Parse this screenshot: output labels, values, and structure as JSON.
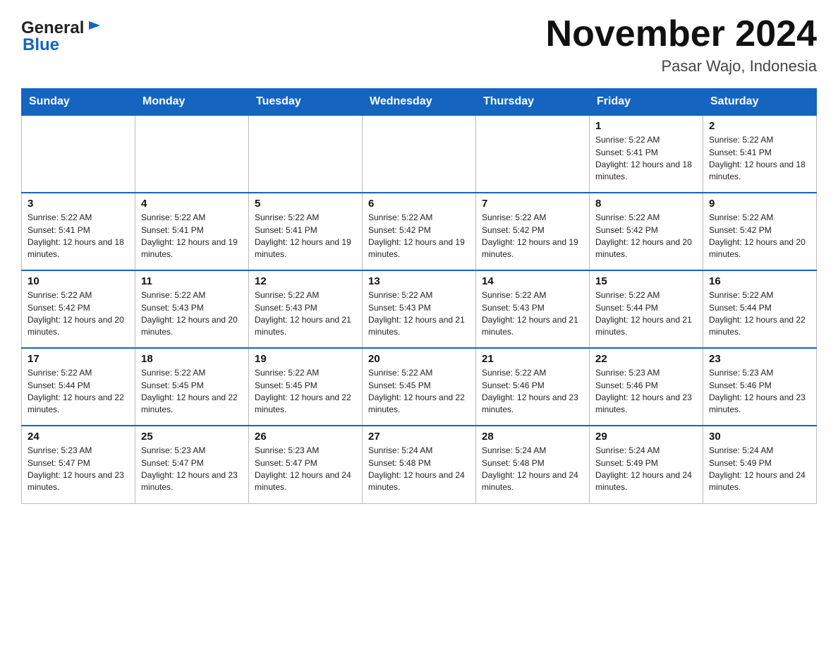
{
  "header": {
    "logo_general": "General",
    "logo_blue": "Blue",
    "month_title": "November 2024",
    "location": "Pasar Wajo, Indonesia"
  },
  "weekdays": [
    "Sunday",
    "Monday",
    "Tuesday",
    "Wednesday",
    "Thursday",
    "Friday",
    "Saturday"
  ],
  "weeks": [
    [
      {
        "day": "",
        "sunrise": "",
        "sunset": "",
        "daylight": "",
        "empty": true
      },
      {
        "day": "",
        "sunrise": "",
        "sunset": "",
        "daylight": "",
        "empty": true
      },
      {
        "day": "",
        "sunrise": "",
        "sunset": "",
        "daylight": "",
        "empty": true
      },
      {
        "day": "",
        "sunrise": "",
        "sunset": "",
        "daylight": "",
        "empty": true
      },
      {
        "day": "",
        "sunrise": "",
        "sunset": "",
        "daylight": "",
        "empty": true
      },
      {
        "day": "1",
        "sunrise": "Sunrise: 5:22 AM",
        "sunset": "Sunset: 5:41 PM",
        "daylight": "Daylight: 12 hours and 18 minutes.",
        "empty": false
      },
      {
        "day": "2",
        "sunrise": "Sunrise: 5:22 AM",
        "sunset": "Sunset: 5:41 PM",
        "daylight": "Daylight: 12 hours and 18 minutes.",
        "empty": false
      }
    ],
    [
      {
        "day": "3",
        "sunrise": "Sunrise: 5:22 AM",
        "sunset": "Sunset: 5:41 PM",
        "daylight": "Daylight: 12 hours and 18 minutes.",
        "empty": false
      },
      {
        "day": "4",
        "sunrise": "Sunrise: 5:22 AM",
        "sunset": "Sunset: 5:41 PM",
        "daylight": "Daylight: 12 hours and 19 minutes.",
        "empty": false
      },
      {
        "day": "5",
        "sunrise": "Sunrise: 5:22 AM",
        "sunset": "Sunset: 5:41 PM",
        "daylight": "Daylight: 12 hours and 19 minutes.",
        "empty": false
      },
      {
        "day": "6",
        "sunrise": "Sunrise: 5:22 AM",
        "sunset": "Sunset: 5:42 PM",
        "daylight": "Daylight: 12 hours and 19 minutes.",
        "empty": false
      },
      {
        "day": "7",
        "sunrise": "Sunrise: 5:22 AM",
        "sunset": "Sunset: 5:42 PM",
        "daylight": "Daylight: 12 hours and 19 minutes.",
        "empty": false
      },
      {
        "day": "8",
        "sunrise": "Sunrise: 5:22 AM",
        "sunset": "Sunset: 5:42 PM",
        "daylight": "Daylight: 12 hours and 20 minutes.",
        "empty": false
      },
      {
        "day": "9",
        "sunrise": "Sunrise: 5:22 AM",
        "sunset": "Sunset: 5:42 PM",
        "daylight": "Daylight: 12 hours and 20 minutes.",
        "empty": false
      }
    ],
    [
      {
        "day": "10",
        "sunrise": "Sunrise: 5:22 AM",
        "sunset": "Sunset: 5:42 PM",
        "daylight": "Daylight: 12 hours and 20 minutes.",
        "empty": false
      },
      {
        "day": "11",
        "sunrise": "Sunrise: 5:22 AM",
        "sunset": "Sunset: 5:43 PM",
        "daylight": "Daylight: 12 hours and 20 minutes.",
        "empty": false
      },
      {
        "day": "12",
        "sunrise": "Sunrise: 5:22 AM",
        "sunset": "Sunset: 5:43 PM",
        "daylight": "Daylight: 12 hours and 21 minutes.",
        "empty": false
      },
      {
        "day": "13",
        "sunrise": "Sunrise: 5:22 AM",
        "sunset": "Sunset: 5:43 PM",
        "daylight": "Daylight: 12 hours and 21 minutes.",
        "empty": false
      },
      {
        "day": "14",
        "sunrise": "Sunrise: 5:22 AM",
        "sunset": "Sunset: 5:43 PM",
        "daylight": "Daylight: 12 hours and 21 minutes.",
        "empty": false
      },
      {
        "day": "15",
        "sunrise": "Sunrise: 5:22 AM",
        "sunset": "Sunset: 5:44 PM",
        "daylight": "Daylight: 12 hours and 21 minutes.",
        "empty": false
      },
      {
        "day": "16",
        "sunrise": "Sunrise: 5:22 AM",
        "sunset": "Sunset: 5:44 PM",
        "daylight": "Daylight: 12 hours and 22 minutes.",
        "empty": false
      }
    ],
    [
      {
        "day": "17",
        "sunrise": "Sunrise: 5:22 AM",
        "sunset": "Sunset: 5:44 PM",
        "daylight": "Daylight: 12 hours and 22 minutes.",
        "empty": false
      },
      {
        "day": "18",
        "sunrise": "Sunrise: 5:22 AM",
        "sunset": "Sunset: 5:45 PM",
        "daylight": "Daylight: 12 hours and 22 minutes.",
        "empty": false
      },
      {
        "day": "19",
        "sunrise": "Sunrise: 5:22 AM",
        "sunset": "Sunset: 5:45 PM",
        "daylight": "Daylight: 12 hours and 22 minutes.",
        "empty": false
      },
      {
        "day": "20",
        "sunrise": "Sunrise: 5:22 AM",
        "sunset": "Sunset: 5:45 PM",
        "daylight": "Daylight: 12 hours and 22 minutes.",
        "empty": false
      },
      {
        "day": "21",
        "sunrise": "Sunrise: 5:22 AM",
        "sunset": "Sunset: 5:46 PM",
        "daylight": "Daylight: 12 hours and 23 minutes.",
        "empty": false
      },
      {
        "day": "22",
        "sunrise": "Sunrise: 5:23 AM",
        "sunset": "Sunset: 5:46 PM",
        "daylight": "Daylight: 12 hours and 23 minutes.",
        "empty": false
      },
      {
        "day": "23",
        "sunrise": "Sunrise: 5:23 AM",
        "sunset": "Sunset: 5:46 PM",
        "daylight": "Daylight: 12 hours and 23 minutes.",
        "empty": false
      }
    ],
    [
      {
        "day": "24",
        "sunrise": "Sunrise: 5:23 AM",
        "sunset": "Sunset: 5:47 PM",
        "daylight": "Daylight: 12 hours and 23 minutes.",
        "empty": false
      },
      {
        "day": "25",
        "sunrise": "Sunrise: 5:23 AM",
        "sunset": "Sunset: 5:47 PM",
        "daylight": "Daylight: 12 hours and 23 minutes.",
        "empty": false
      },
      {
        "day": "26",
        "sunrise": "Sunrise: 5:23 AM",
        "sunset": "Sunset: 5:47 PM",
        "daylight": "Daylight: 12 hours and 24 minutes.",
        "empty": false
      },
      {
        "day": "27",
        "sunrise": "Sunrise: 5:24 AM",
        "sunset": "Sunset: 5:48 PM",
        "daylight": "Daylight: 12 hours and 24 minutes.",
        "empty": false
      },
      {
        "day": "28",
        "sunrise": "Sunrise: 5:24 AM",
        "sunset": "Sunset: 5:48 PM",
        "daylight": "Daylight: 12 hours and 24 minutes.",
        "empty": false
      },
      {
        "day": "29",
        "sunrise": "Sunrise: 5:24 AM",
        "sunset": "Sunset: 5:49 PM",
        "daylight": "Daylight: 12 hours and 24 minutes.",
        "empty": false
      },
      {
        "day": "30",
        "sunrise": "Sunrise: 5:24 AM",
        "sunset": "Sunset: 5:49 PM",
        "daylight": "Daylight: 12 hours and 24 minutes.",
        "empty": false
      }
    ]
  ]
}
